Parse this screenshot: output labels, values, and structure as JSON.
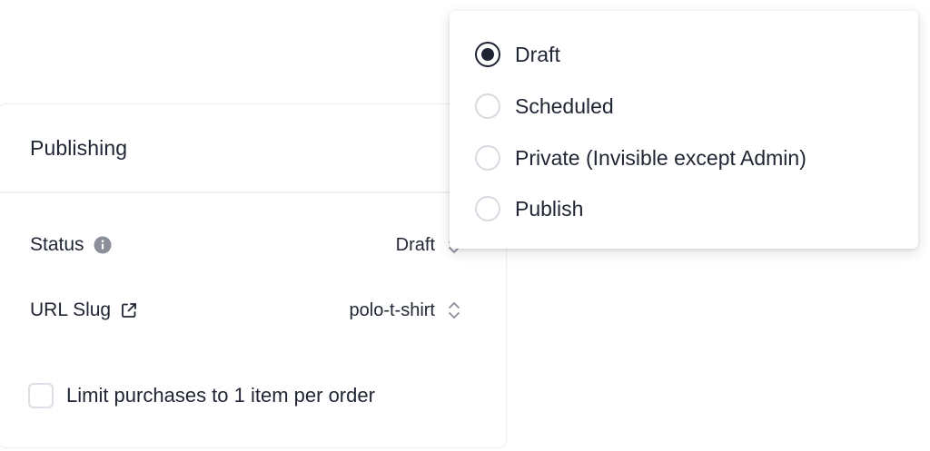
{
  "publishing": {
    "title": "Publishing",
    "status": {
      "label": "Status",
      "value": "Draft",
      "info_icon": "info-icon",
      "chevron_icon": "chevron-up-down-icon"
    },
    "url_slug": {
      "label": "URL Slug",
      "value": "polo-t-shirt",
      "external_icon": "external-link-icon",
      "chevron_icon": "chevron-up-down-icon"
    },
    "limit_checkbox": {
      "label": "Limit purchases to 1 item per order",
      "checked": false
    }
  },
  "status_dropdown": {
    "selected": "Draft",
    "options": [
      {
        "label": "Draft",
        "checked": true
      },
      {
        "label": "Scheduled",
        "checked": false
      },
      {
        "label": "Private (Invisible except Admin)",
        "checked": false
      },
      {
        "label": "Publish",
        "checked": false
      }
    ]
  },
  "colors": {
    "text": "#1f2533",
    "border": "#eceef2",
    "radio_border": "#d7dae0",
    "icon_gray": "#8a8f99"
  }
}
